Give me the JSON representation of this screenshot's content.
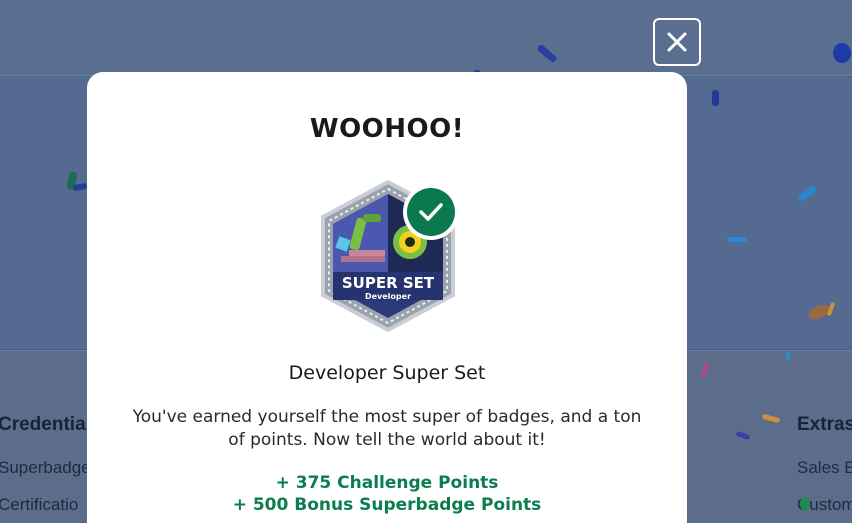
{
  "background": {
    "left_heading": "Credentia",
    "left_items": [
      "Superbadge",
      "Certificatio"
    ],
    "right_heading": "Extras",
    "right_items": [
      "Sales E",
      "Custom"
    ]
  },
  "modal": {
    "close_icon": "close-icon",
    "headline": "WOOHOO!",
    "badge": {
      "icon": "super-set-badge",
      "banner": "SUPER SET",
      "subtitle": "Developer",
      "status_icon": "checkmark-icon"
    },
    "title": "Developer Super Set",
    "description": "You've earned yourself the most super of badges, and a ton of points. Now tell the world about it!",
    "challenge_points": "+ 375 Challenge Points",
    "bonus_points": "+ 500 Bonus Superbadge Points"
  },
  "colors": {
    "accent_green": "#0b7d4f",
    "overlay": "#4b6288",
    "badge_navy": "#2b3a7a"
  }
}
